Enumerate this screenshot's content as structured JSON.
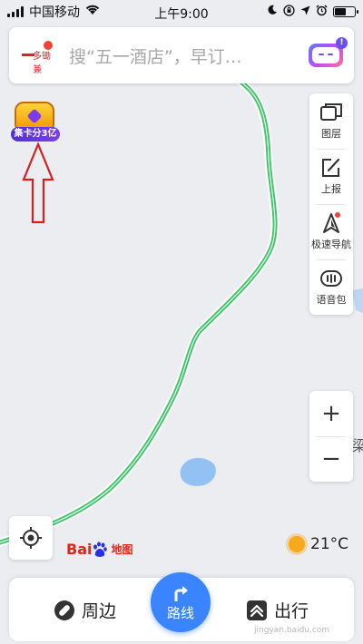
{
  "status_bar": {
    "carrier": "中国移动",
    "time": "上午9:00",
    "battery_level": 0.55
  },
  "search": {
    "logo_text": "多锄兼",
    "placeholder": "搜“五一酒店”，早订…",
    "bot_badge": "!"
  },
  "promo": {
    "label": "集卡分3亿"
  },
  "toolbar": {
    "items": [
      {
        "label": "图层",
        "icon": "layers-icon"
      },
      {
        "label": "上报",
        "icon": "report-edit-icon"
      },
      {
        "label": "极速导航",
        "icon": "navigation-arrow-icon"
      },
      {
        "label": "语音包",
        "icon": "voice-pack-icon"
      }
    ]
  },
  "zoom": {
    "in_label": "+",
    "out_label": "−"
  },
  "map": {
    "brand_part1": "Bai",
    "brand_part2": "du",
    "brand_part3": "地图",
    "edge_text": "梁",
    "route_color": "#3fc56a"
  },
  "weather": {
    "temperature": "21°C"
  },
  "bottom_bar": {
    "nearby_label": "周边",
    "route_label": "路线",
    "travel_label": "出行",
    "watermark": "jingyan.baidu.com"
  },
  "colors": {
    "accent": "#3a85ff",
    "annotation_arrow": "#d42020"
  }
}
